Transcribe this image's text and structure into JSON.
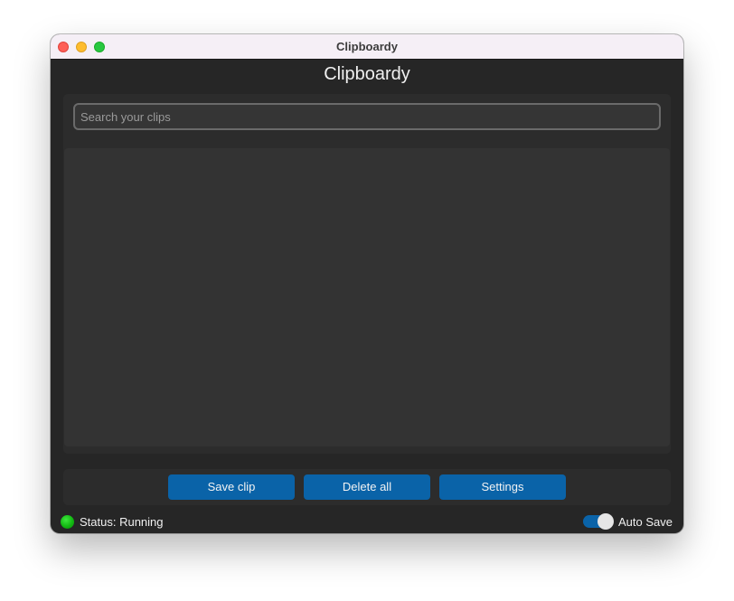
{
  "window": {
    "title": "Clipboardy"
  },
  "app": {
    "title": "Clipboardy"
  },
  "search": {
    "value": "",
    "placeholder": "Search your clips"
  },
  "clips": [],
  "buttons": {
    "save_label": "Save clip",
    "delete_label": "Delete all",
    "settings_label": "Settings"
  },
  "status": {
    "text": "Status: Running",
    "color": "#18c018"
  },
  "auto_save": {
    "label": "Auto Save",
    "enabled": true
  },
  "colors": {
    "accent": "#0a63a8",
    "background": "#262626"
  }
}
